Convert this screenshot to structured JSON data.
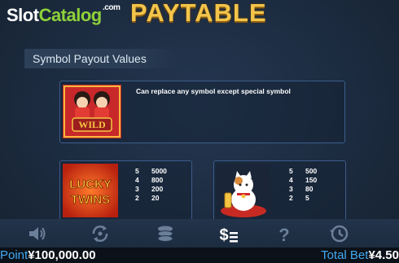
{
  "header": {
    "logo_part1": "Slot",
    "logo_part2": "Catalog",
    "logo_com": ".com",
    "title": "PAYTABLE"
  },
  "section": {
    "label": "Symbol Payout Values"
  },
  "symbols": [
    {
      "name": "wild",
      "image_text": "WILD",
      "description": "Can replace any symbol except special symbol"
    },
    {
      "name": "lucky-twins",
      "image_text_1": "LUCKY",
      "image_text_2": "TWINS",
      "payouts": [
        {
          "count": "5",
          "value": "5000"
        },
        {
          "count": "4",
          "value": "800"
        },
        {
          "count": "3",
          "value": "200"
        },
        {
          "count": "2",
          "value": "20"
        }
      ]
    },
    {
      "name": "lucky-cat",
      "payouts": [
        {
          "count": "5",
          "value": "500"
        },
        {
          "count": "4",
          "value": "150"
        },
        {
          "count": "3",
          "value": "80"
        },
        {
          "count": "2",
          "value": "5"
        }
      ]
    }
  ],
  "toolbar": {
    "icons": [
      "sound-icon",
      "autoplay-icon",
      "chips-icon",
      "paytable-icon",
      "help-icon",
      "history-icon"
    ],
    "active": "paytable-icon"
  },
  "status": {
    "point_label": "Point",
    "point_value": "¥100,000.00",
    "bet_label": "Total Bet",
    "bet_value": "¥4.50"
  },
  "colors": {
    "title_gold": "#f3c54a",
    "logo_green": "#8ed13a",
    "status_label": "#44a8f0",
    "card_border": "#3d5d8c"
  }
}
